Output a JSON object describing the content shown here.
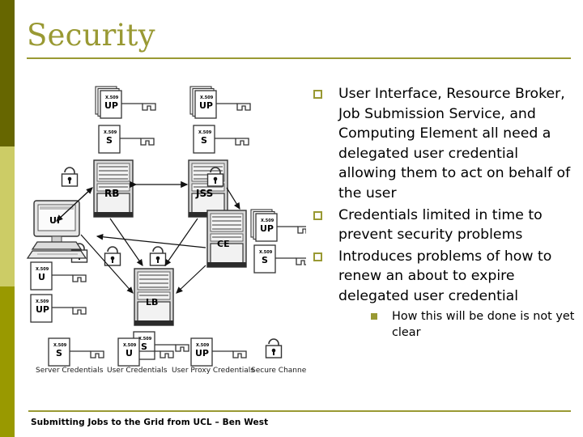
{
  "slide": {
    "title": "Security",
    "accent_color": "#999933",
    "band_dark_color": "#666600",
    "band_light_color": "#cccc66",
    "band_mid_color": "#999900",
    "background_color": "#ffffff"
  },
  "bullets": [
    {
      "marker": "hollow-square",
      "text": "User Interface, Resource Broker, Job Submission Service, and Computing Element all need a delegated user credential allowing them to act on behalf of the user"
    },
    {
      "marker": "hollow-square",
      "text": "Credentials limited in time to prevent security problems"
    },
    {
      "marker": "hollow-square",
      "text": "Introduces problems of how to renew an about to expire delegated user credential",
      "subbullets": [
        {
          "marker": "filled-square",
          "text": "How this will be done is not yet clear"
        }
      ]
    }
  ],
  "footer": {
    "text": "Submitting Jobs to the Grid from UCL – Ben West"
  },
  "diagram": {
    "nodes": [
      {
        "id": "rb",
        "label": "RB",
        "type": "server"
      },
      {
        "id": "jss",
        "label": "JSS",
        "type": "server"
      },
      {
        "id": "ui",
        "label": "UI",
        "type": "workstation"
      },
      {
        "id": "ce",
        "label": "CE",
        "type": "server"
      },
      {
        "id": "lb",
        "label": "LB",
        "type": "server"
      }
    ],
    "credential_label": "X.509",
    "credential_kinds": {
      "server": "S",
      "user": "U",
      "user_proxy": "UP"
    },
    "legend": [
      {
        "icon": "cert-s",
        "cert_top": "X.509",
        "cert_kind": "S",
        "label": "Server Credentials"
      },
      {
        "icon": "cert-u",
        "cert_top": "X.509",
        "cert_kind": "U",
        "label": "User Credentials"
      },
      {
        "icon": "cert-up",
        "cert_top": "X.509",
        "cert_kind": "UP",
        "label": "User Proxy Credentials"
      },
      {
        "icon": "padlock",
        "cert_top": "",
        "cert_kind": "",
        "label": "Secure Channel"
      }
    ]
  }
}
